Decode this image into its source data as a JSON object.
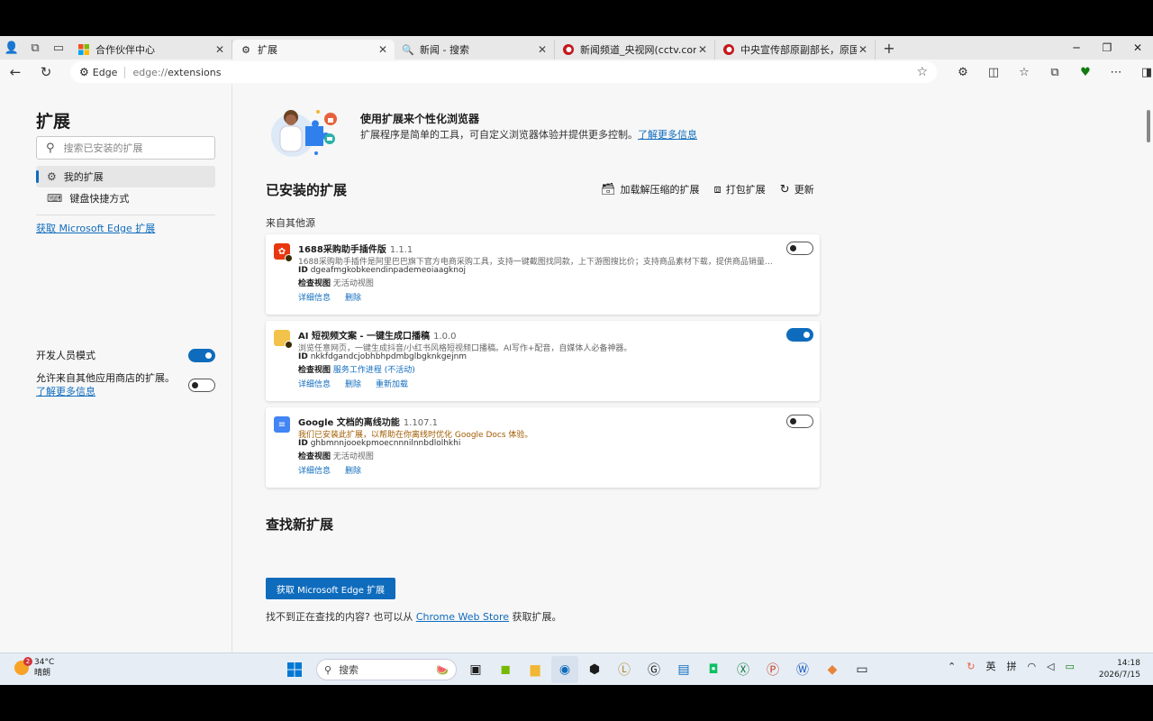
{
  "browser": {
    "tabs": [
      {
        "title": "合作伙伴中心",
        "favicon": "windows-logo-icon",
        "active": false
      },
      {
        "title": "扩展",
        "favicon": "puzzle-icon",
        "active": true
      },
      {
        "title": "新闻 - 搜索",
        "favicon": "search-icon",
        "active": false
      },
      {
        "title": "新闻频道_央视网(cctv.com)",
        "favicon": "cctv-icon",
        "active": false
      },
      {
        "title": "中央宣传部原副部长，原国家新闻",
        "favicon": "cctv-icon",
        "active": false
      }
    ],
    "address": {
      "site_label": "Edge",
      "url_prefix": "edge://",
      "url_path": "extensions"
    }
  },
  "sidebar": {
    "title": "扩展",
    "search_placeholder": "搜索已安装的扩展",
    "items": [
      {
        "label": "我的扩展",
        "icon": "puzzle-icon",
        "selected": true
      },
      {
        "label": "键盘快捷方式",
        "icon": "keyboard-icon",
        "selected": false
      }
    ],
    "get_link": "获取 Microsoft Edge 扩展",
    "dev_mode_label": "开发人员模式",
    "other_stores_label": "允许来自其他应用商店的扩展。",
    "other_stores_link": "了解更多信息"
  },
  "hero": {
    "title": "使用扩展来个性化浏览器",
    "desc": "扩展程序是简单的工具，可自定义浏览器体验并提供更多控制。",
    "link": "了解更多信息"
  },
  "installed": {
    "title": "已安装的扩展",
    "actions": [
      "加载解压缩的扩展",
      "打包扩展",
      "更新"
    ],
    "source_label": "来自其他源",
    "extensions": [
      {
        "name": "1688采购助手插件版",
        "version": "1.1.1",
        "desc": "1688采购助手插件是阿里巴巴旗下官方电商采购工具，支持一键截图找同款，上下游图搜比价；支持商品素材下载，提供商品销量和...",
        "id_label": "ID",
        "id": "dgeafmgkobkeendinpademeoiaagknoj",
        "inspect_label": "检查视图",
        "inspect_value": "无活动视图",
        "links": [
          "详细信息",
          "删除"
        ],
        "enabled": false
      },
      {
        "name": "AI 短视频文案 - 一键生成口播稿",
        "version": "1.0.0",
        "desc": "浏览任意网页，一键生成抖音/小红书风格短视频口播稿。AI写作+配音，自媒体人必备神器。",
        "id_label": "ID",
        "id": "nkkfdgandcjobhbhpdmbglbgknkgejnm",
        "inspect_label": "检查视图",
        "inspect_value": "服务工作进程 (不活动)",
        "links": [
          "详细信息",
          "删除",
          "重新加载"
        ],
        "enabled": true
      },
      {
        "name": "Google 文档的离线功能",
        "version": "1.107.1",
        "desc": "我们已安装此扩展，以帮助在你离线时优化 Google Docs 体验。",
        "id_label": "ID",
        "id": "ghbmnnjooekpmoecnnnilnnbdlolhkhi",
        "inspect_label": "检查视图",
        "inspect_value": "无活动视图",
        "links": [
          "详细信息",
          "删除"
        ],
        "enabled": false
      }
    ]
  },
  "find": {
    "title": "查找新扩展",
    "button": "获取 Microsoft Edge 扩展",
    "text_before": "找不到正在查找的内容? 也可以从",
    "link": "Chrome Web Store",
    "text_after": "获取扩展。"
  },
  "taskbar": {
    "weather_temp": "34°C",
    "weather_desc": "晴朗",
    "weather_badge": "2",
    "search_label": "搜索",
    "ime_lang": "英",
    "ime_mode": "拼",
    "time": "14:18",
    "date": "2026/7/15"
  },
  "colors": {
    "accent": "#0f6cbd",
    "warning_text": "#a25b00"
  }
}
